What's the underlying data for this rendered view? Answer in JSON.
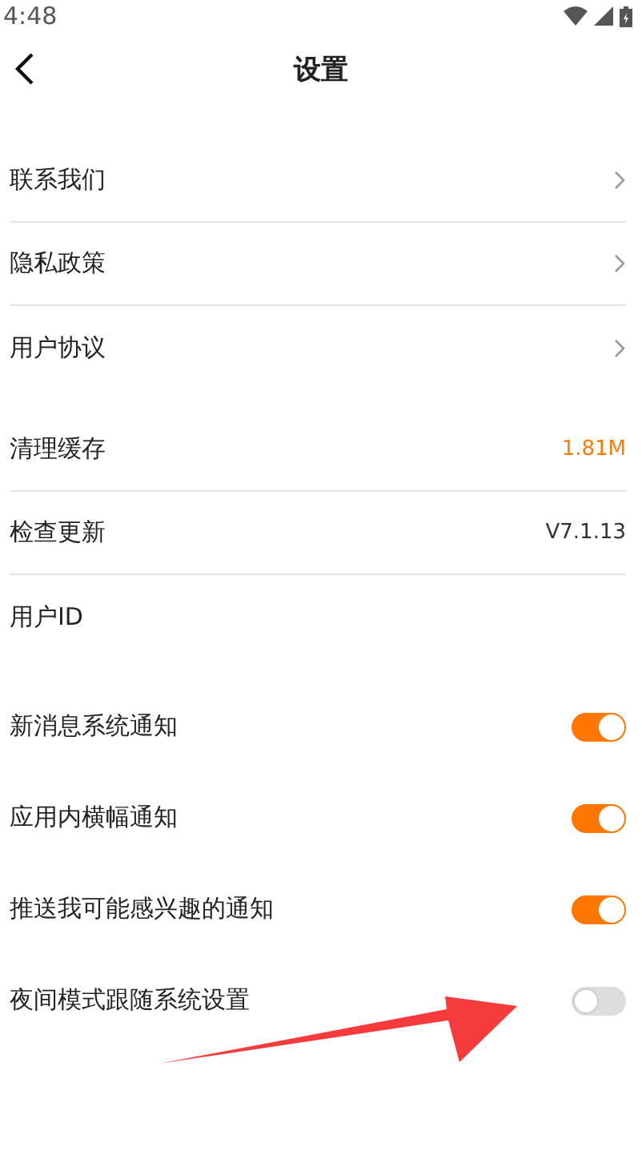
{
  "status_bar": {
    "time": "4:48"
  },
  "header": {
    "title": "设置"
  },
  "sections": [
    {
      "items": [
        {
          "kind": "link",
          "label": "联系我们"
        },
        {
          "kind": "link",
          "label": "隐私政策"
        },
        {
          "kind": "link",
          "label": "用户协议"
        }
      ]
    },
    {
      "items": [
        {
          "kind": "value",
          "label": "清理缓存",
          "value": "1.81M",
          "accent": true
        },
        {
          "kind": "value",
          "label": "检查更新",
          "value": "V7.1.13",
          "accent": false
        },
        {
          "kind": "plain",
          "label": "用户ID"
        }
      ]
    },
    {
      "items": [
        {
          "kind": "toggle",
          "label": "新消息系统通知",
          "on": true
        },
        {
          "kind": "toggle",
          "label": "应用内横幅通知",
          "on": true
        },
        {
          "kind": "toggle",
          "label": "推送我可能感兴趣的通知",
          "on": true
        },
        {
          "kind": "toggle",
          "label": "夜间模式跟随系统设置",
          "on": false
        }
      ]
    }
  ]
}
